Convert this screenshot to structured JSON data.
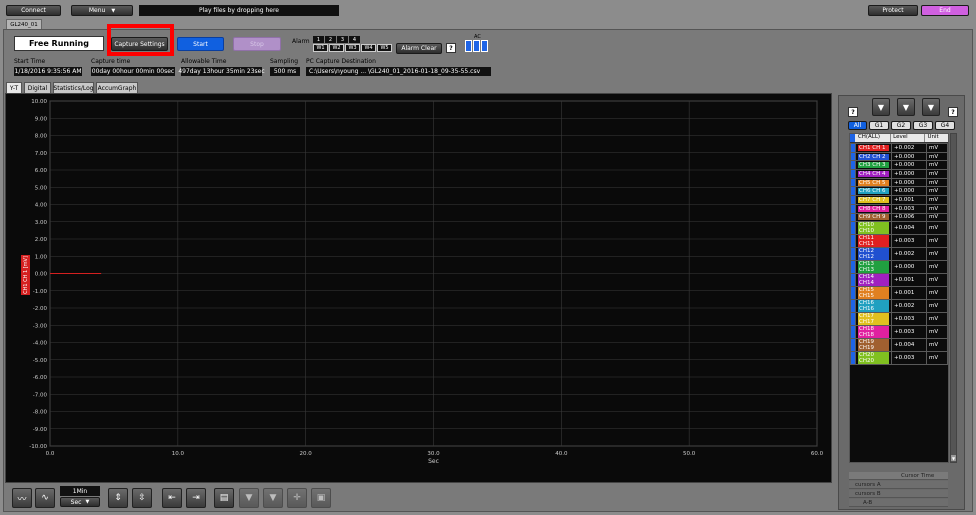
{
  "toolbar": {
    "connect": "Connect",
    "menu": "Menu",
    "status": "Play files by dropping here",
    "protect": "Protect",
    "end": "End"
  },
  "device_tab": "GL240_01",
  "control": {
    "mode": "Free Running",
    "capture_settings": "Capture Settings",
    "start": "Start",
    "stop": "Stop",
    "alarm_label": "Alarm",
    "alarm_top": [
      "1",
      "2",
      "3",
      "4"
    ],
    "alarm_bottom": [
      "W1",
      "W2",
      "W3",
      "W4",
      "W5"
    ],
    "alarm_clear": "Alarm Clear",
    "help": "?",
    "ac": "AC"
  },
  "info": {
    "start_time_label": "Start Time",
    "start_time": "1/18/2016 9:35:56 AM",
    "capture_time_label": "Capture time",
    "capture_time": "00day 00hour 00min 00sec",
    "allowable_label": "Allowable Time",
    "allowable": "497day 13hour 35min 23sec",
    "sampling_label": "Sampling",
    "sampling": "500 ms",
    "dest_label": "PC Capture Destination",
    "dest": "C:\\Users\\nyoung ... \\GL240_01_2016-01-18_09-35-55.csv"
  },
  "view_tabs": [
    "Y-T",
    "Digital",
    "Statistics/Log",
    "AccumGraph"
  ],
  "chart_data": {
    "type": "line",
    "ylabel": "CH1 CH 1 [mV]",
    "xlabel": "Sec",
    "ylim": [
      -10,
      10
    ],
    "xlim": [
      0,
      60
    ],
    "y_ticks": [
      "10.00",
      "9.00",
      "8.00",
      "7.00",
      "6.00",
      "5.00",
      "4.00",
      "3.00",
      "2.00",
      "1.00",
      "0.00",
      "-1.00",
      "-2.00",
      "-3.00",
      "-4.00",
      "-5.00",
      "-6.00",
      "-7.00",
      "-8.00",
      "-9.00",
      "-10.00"
    ],
    "x_ticks": [
      "0.0",
      "10.0",
      "20.0",
      "30.0",
      "40.0",
      "50.0",
      "60.0"
    ],
    "series": [
      {
        "x": [
          0,
          4
        ],
        "y": [
          0.0,
          0.0
        ],
        "color": "#d42020"
      }
    ]
  },
  "bottom_toolbar": {
    "span": "1Min",
    "unit": "Sec"
  },
  "groups": {
    "help_left": "?",
    "help_right": "?",
    "tabs": [
      "All",
      "G1",
      "G2",
      "G3",
      "G4"
    ]
  },
  "channel_table": {
    "headers": [
      "CH(ALL)",
      "Level",
      "Unit"
    ],
    "rows": [
      {
        "ch": "CH1 CH 1",
        "level": "+0.002",
        "unit": "mV",
        "color": "#e02020"
      },
      {
        "ch": "CH2 CH 2",
        "level": "+0.000",
        "unit": "mV",
        "color": "#2050d0"
      },
      {
        "ch": "CH3 CH 3",
        "level": "+0.000",
        "unit": "mV",
        "color": "#20a040"
      },
      {
        "ch": "CH4 CH 4",
        "level": "+0.000",
        "unit": "mV",
        "color": "#a020c0"
      },
      {
        "ch": "CH5 CH 5",
        "level": "+0.000",
        "unit": "mV",
        "color": "#e08020"
      },
      {
        "ch": "CH6 CH 6",
        "level": "+0.000",
        "unit": "mV",
        "color": "#20a0c0"
      },
      {
        "ch": "CH7 CH 7",
        "level": "+0.001",
        "unit": "mV",
        "color": "#e0c020"
      },
      {
        "ch": "CH8 CH 8",
        "level": "+0.003",
        "unit": "mV",
        "color": "#e020a0"
      },
      {
        "ch": "CH9 CH 9",
        "level": "+0.006",
        "unit": "mV",
        "color": "#a06030"
      },
      {
        "ch": "CH10 CH10",
        "level": "+0.004",
        "unit": "mV",
        "color": "#80c020"
      },
      {
        "ch": "CH11 CH11",
        "level": "+0.003",
        "unit": "mV",
        "color": "#e02020"
      },
      {
        "ch": "CH12 CH12",
        "level": "+0.002",
        "unit": "mV",
        "color": "#2050d0"
      },
      {
        "ch": "CH13 CH13",
        "level": "+0.000",
        "unit": "mV",
        "color": "#20a040"
      },
      {
        "ch": "CH14 CH14",
        "level": "+0.001",
        "unit": "mV",
        "color": "#a020c0"
      },
      {
        "ch": "CH15 CH15",
        "level": "+0.001",
        "unit": "mV",
        "color": "#e08020"
      },
      {
        "ch": "CH16 CH16",
        "level": "+0.002",
        "unit": "mV",
        "color": "#20a0c0"
      },
      {
        "ch": "CH17 CH17",
        "level": "+0.003",
        "unit": "mV",
        "color": "#e0c020"
      },
      {
        "ch": "CH18 CH18",
        "level": "+0.003",
        "unit": "mV",
        "color": "#e020a0"
      },
      {
        "ch": "CH19 CH19",
        "level": "+0.004",
        "unit": "mV",
        "color": "#a06030"
      },
      {
        "ch": "CH20 CH20",
        "level": "+0.003",
        "unit": "mV",
        "color": "#80c020"
      }
    ]
  },
  "cursor": {
    "header": "Cursor Time",
    "rows": [
      "cursors A",
      "cursors B",
      "A-B"
    ]
  },
  "colors": {
    "accent_blue": "#1060e0",
    "end_button": "#d060e0",
    "highlight": "#ff0000"
  }
}
